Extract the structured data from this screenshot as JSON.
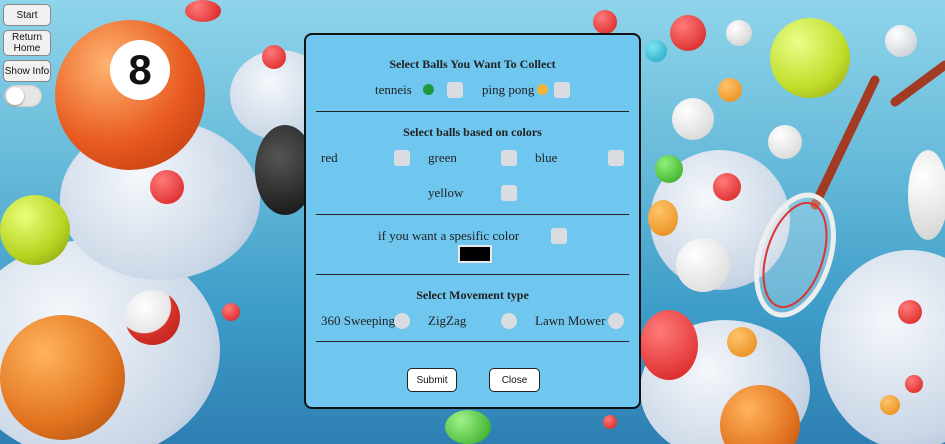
{
  "sidebar": {
    "start_label": "Start",
    "return_home_label": "Return Home",
    "show_info_label": "Show Info"
  },
  "modal": {
    "ball_section": {
      "title": "Select Balls You Want To Collect",
      "tennis_label": "tenneis",
      "pingpong_label": "ping pong"
    },
    "color_section": {
      "title": "Select balls based on colors",
      "red_label": "red",
      "green_label": "green",
      "blue_label": "blue",
      "yellow_label": "yellow"
    },
    "specific_color": {
      "label": "if you want a spesific color",
      "color_value": "#000000"
    },
    "movement_section": {
      "title": "Select Movement type",
      "sweeping_label": "360 Sweeping",
      "zigzag_label": "ZigZag",
      "lawnmower_label": "Lawn Mower"
    },
    "submit_label": "Submit",
    "close_label": "Close"
  },
  "colors": {
    "modal_bg": "#6fc6ef",
    "checkbox": "#d9dde2",
    "tennis_icon": "#1f9a3a",
    "pingpong_icon": "#f2b43a"
  }
}
